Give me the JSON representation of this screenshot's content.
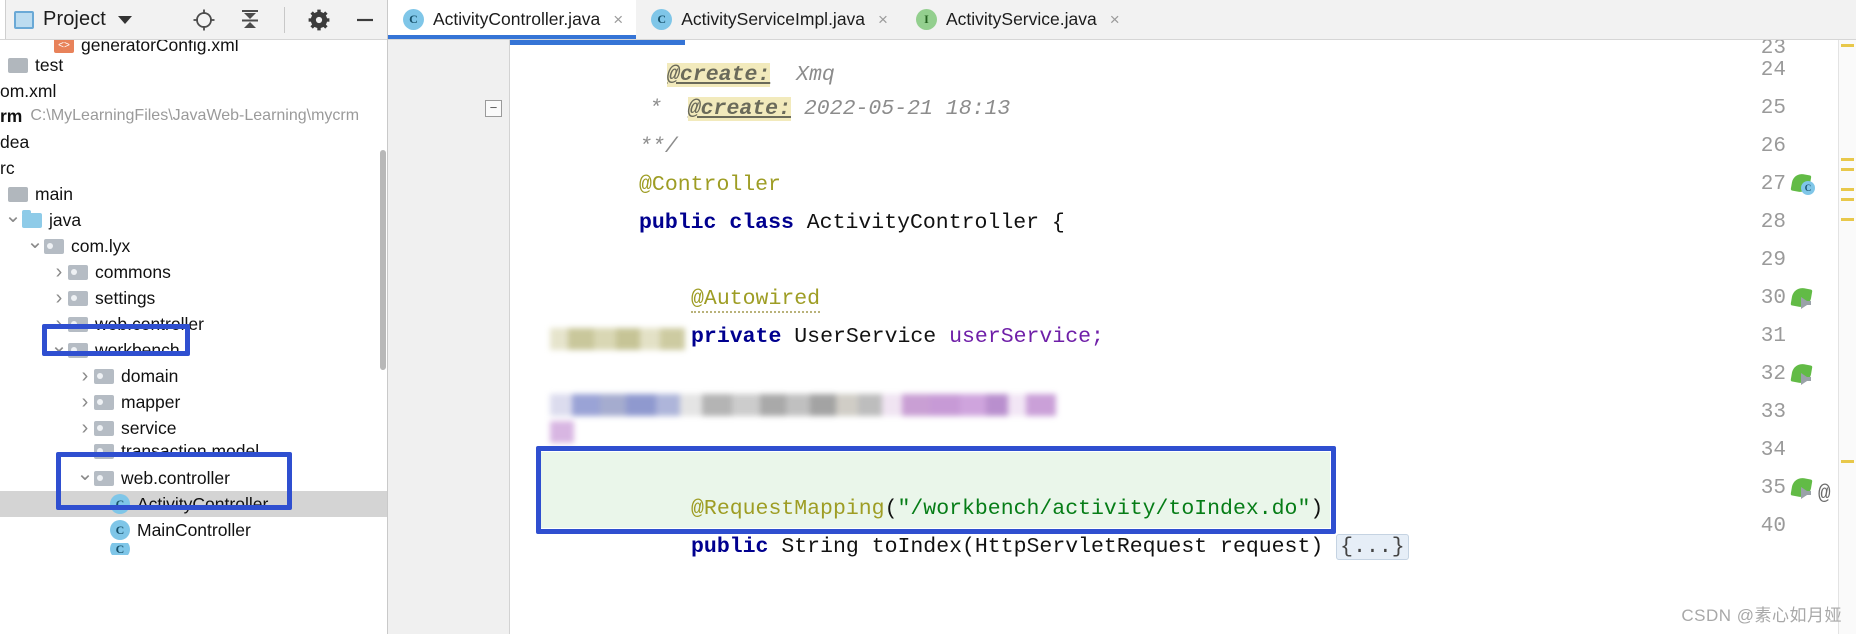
{
  "sidebar": {
    "title": "Project",
    "icons": [
      "locate-icon",
      "collapse-all-icon",
      "settings-icon",
      "minimize-icon"
    ],
    "tree": [
      {
        "label": "generatorConfig.xml",
        "icon": "xml-file-icon",
        "indent": 2,
        "arrow": "none",
        "style": "cut-top"
      },
      {
        "label": "test",
        "icon": "folder-gray-icon",
        "indent": 0,
        "arrow": "none",
        "style": "normal"
      },
      {
        "label": "om.xml",
        "icon": "none",
        "indent": 0,
        "arrow": "none",
        "style": "clipped"
      },
      {
        "label": "rm",
        "icon": "none",
        "indent": 0,
        "arrow": "none",
        "style": "bold-clipped",
        "suffix": "C:\\MyLearningFiles\\JavaWeb-Learning\\mycrm"
      },
      {
        "label": "dea",
        "icon": "none",
        "indent": 0,
        "arrow": "none",
        "style": "clipped"
      },
      {
        "label": "rc",
        "icon": "none",
        "indent": 0,
        "arrow": "none",
        "style": "clipped"
      },
      {
        "label": "main",
        "icon": "folder-gray-icon",
        "indent": 0,
        "arrow": "none",
        "style": "normal"
      },
      {
        "label": "java",
        "icon": "folder-blue-icon",
        "indent": 1,
        "arrow": "down",
        "style": "normal"
      },
      {
        "label": "com.lyx",
        "icon": "package-icon",
        "indent": 2,
        "arrow": "down",
        "style": "normal"
      },
      {
        "label": "commons",
        "icon": "package-icon",
        "indent": 3,
        "arrow": "right",
        "style": "normal"
      },
      {
        "label": "settings",
        "icon": "package-icon",
        "indent": 3,
        "arrow": "right",
        "style": "normal"
      },
      {
        "label": "web.controller",
        "icon": "package-icon",
        "indent": 3,
        "arrow": "right",
        "style": "normal"
      },
      {
        "label": "workbench",
        "icon": "package-icon",
        "indent": 3,
        "arrow": "down",
        "style": "normal"
      },
      {
        "label": "domain",
        "icon": "package-icon",
        "indent": 4,
        "arrow": "right",
        "style": "normal"
      },
      {
        "label": "mapper",
        "icon": "package-icon",
        "indent": 4,
        "arrow": "right",
        "style": "normal"
      },
      {
        "label": "service",
        "icon": "package-icon",
        "indent": 4,
        "arrow": "right",
        "style": "normal"
      },
      {
        "label": "transaction model",
        "icon": "package-icon",
        "indent": 4,
        "arrow": "none",
        "style": "normal"
      },
      {
        "label": "web.controller",
        "icon": "package-icon",
        "indent": 4,
        "arrow": "down",
        "style": "normal"
      },
      {
        "label": "ActivityController",
        "icon": "java-class-icon",
        "indent": 5,
        "arrow": "none",
        "style": "selected"
      },
      {
        "label": "MainController",
        "icon": "java-class-icon",
        "indent": 5,
        "arrow": "none",
        "style": "normal"
      }
    ],
    "annotations": [
      {
        "name": "workbench-highlight-box",
        "color": "#2f4fd0"
      },
      {
        "name": "web-controller-activitycontroller-highlight-box",
        "color": "#2f4fd0"
      }
    ]
  },
  "editor": {
    "tabs": [
      {
        "label": "ActivityController.java",
        "icon": "java-class-icon",
        "active": true,
        "close": "×"
      },
      {
        "label": "ActivityServiceImpl.java",
        "icon": "java-class-icon",
        "active": false,
        "close": "×"
      },
      {
        "label": "ActivityService.java",
        "icon": "java-interface-icon",
        "active": false,
        "close": "×"
      }
    ],
    "lines": [
      {
        "num": "23",
        "gutter": "none",
        "text": "partial",
        "clipped": true
      },
      {
        "num": "24",
        "gutter": "none",
        "text": "doc-create"
      },
      {
        "num": "25",
        "gutter": "fold-end",
        "text": "doc-end"
      },
      {
        "num": "26",
        "gutter": "none",
        "text": "controller-anno"
      },
      {
        "num": "27",
        "gutter": "spring-bean-class-icon",
        "text": "class-decl"
      },
      {
        "num": "28",
        "gutter": "none",
        "text": ""
      },
      {
        "num": "29",
        "gutter": "none",
        "text": "autowired-anno"
      },
      {
        "num": "30",
        "gutter": "spring-bean-icon",
        "text": "field-decl"
      },
      {
        "num": "31",
        "gutter": "none",
        "text": "redacted-short"
      },
      {
        "num": "32",
        "gutter": "spring-bean-icon",
        "text": "redacted-long"
      },
      {
        "num": "33",
        "gutter": "none",
        "text": ""
      },
      {
        "num": "34",
        "gutter": "none",
        "text": "request-mapping"
      },
      {
        "num": "35",
        "gutter": "spring-bean-icon-at",
        "text": "to-index-method"
      },
      {
        "num": "40",
        "gutter": "none",
        "text": ""
      }
    ],
    "code": {
      "l24_star": "*",
      "l24_tag": "@create:",
      "l24_date": "2022-05-21 18:13",
      "l25": "**/",
      "l26": "@Controller",
      "l27_pub": "public",
      "l27_class": "class",
      "l27_name": "ActivityController {",
      "l29": "@Autowired",
      "l30_priv": "private",
      "l30_type": "UserService",
      "l30_field": "userService;",
      "l34_anno": "@RequestMapping",
      "l34_open": "(",
      "l34_str": "\"/workbench/activity/toIndex.do\"",
      "l34_close": ")",
      "l35_pub": "public",
      "l35_ret": "String",
      "l35_sig": "toIndex(HttpServletRequest request)",
      "l35_fold": "{...}"
    },
    "annotations": [
      {
        "name": "request-mapping-highlight-box",
        "color": "#2f4fd0"
      }
    ],
    "redacted_note": "blurred code lines 31 and 32"
  },
  "watermark": "CSDN @素心如月娅",
  "colors": {
    "annotation_blue": "#2f4fd0",
    "tab_active_underline": "#3574d6",
    "keyword": "#00008f",
    "annotation_text": "#9e9d24",
    "string": "#067d17",
    "field": "#6f1fa8",
    "selection_gray": "#d4d4d4",
    "code_highlight_green": "#eaf6ea"
  }
}
